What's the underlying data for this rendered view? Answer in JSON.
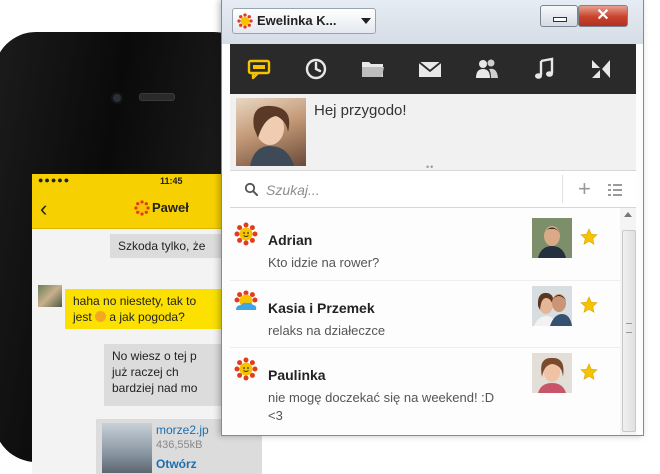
{
  "phone": {
    "status_dots": "●●●●●",
    "status_time": "11:45",
    "back_glyph": "‹",
    "chat_name": "Paweł",
    "messages": [
      {
        "text": "Szkoda tylko, że"
      },
      {
        "text_a": "haha no niestety, tak to",
        "text_b": "jest",
        "text_c": "a jak pogoda?"
      },
      {
        "lines": [
          "No wiesz o tej p",
          "już raczej ch",
          "bardziej nad mo"
        ]
      }
    ],
    "file": {
      "name": "morze2.jp",
      "size": "436,55kB",
      "open_label": "Otwórz"
    }
  },
  "window": {
    "account_name": "Ewelinka K...",
    "close_glyph": "✕",
    "toolbar": [
      {
        "name": "chat-icon"
      },
      {
        "name": "clock-icon"
      },
      {
        "name": "folder-icon"
      },
      {
        "name": "mail-icon"
      },
      {
        "name": "contacts-icon"
      },
      {
        "name": "music-icon"
      },
      {
        "name": "collapse-icon"
      }
    ],
    "profile": {
      "status": "Hej przygodo!",
      "grip": "••"
    },
    "search": {
      "placeholder": "Szukaj...",
      "plus_glyph": "+"
    },
    "contacts": [
      {
        "name": "Adrian",
        "desc": "Kto idzie na rower?",
        "icon": "sun-icon"
      },
      {
        "name": "Kasia i Przemek",
        "desc": "relaks na działeczce",
        "icon": "sun-cloud-icon"
      },
      {
        "name": "Paulinka",
        "desc": "nie mogę doczekać się na weekend! :D <3",
        "icon": "sun-icon"
      }
    ]
  },
  "colors": {
    "brand_yellow": "#f6d000",
    "toolbar_bg": "#2a2a2a",
    "toolbar_icon": "#e8e8e8",
    "toolbar_active": "#f6c300",
    "star": "#f6c300",
    "close_red": "#c7422c"
  }
}
